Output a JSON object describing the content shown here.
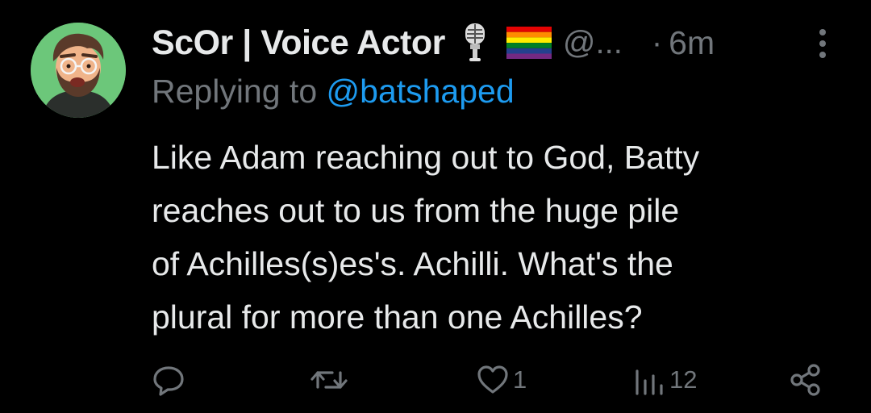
{
  "tweet": {
    "display_name": "ScOr | Voice Actor",
    "badges": [
      "microphone-icon",
      "rainbow-flag-icon"
    ],
    "handle": "@...",
    "separator": "·",
    "timestamp": "6m",
    "reply_prefix": "Replying to ",
    "reply_handle": "@batshaped",
    "text_lines": [
      "Like Adam reaching out to God, Batty",
      "reaches out to us from the huge pile",
      "of Achilles(s)es's. Achilli. What's the",
      "plural for more than one Achilles?"
    ]
  },
  "actions": {
    "reply": {
      "icon": "reply-icon",
      "count": ""
    },
    "retweet": {
      "icon": "retweet-icon",
      "count": ""
    },
    "like": {
      "icon": "heart-icon",
      "count": "1"
    },
    "views": {
      "icon": "views-icon",
      "count": "12"
    },
    "share": {
      "icon": "share-icon",
      "count": ""
    }
  },
  "colors": {
    "background": "#000000",
    "primary_text": "#e7e9ea",
    "secondary_text": "#71767b",
    "link": "#1d9bf0",
    "avatar_bg": "#6cc77a"
  }
}
